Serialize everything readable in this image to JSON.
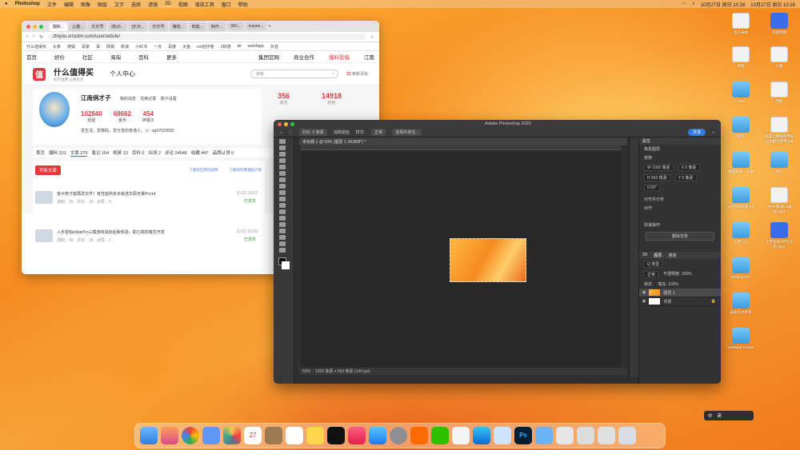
{
  "menubar": {
    "app": "Photoshop",
    "items": [
      "文件",
      "编辑",
      "图像",
      "图层",
      "文字",
      "选择",
      "滤镜",
      "3D",
      "视图",
      "增效工具",
      "窗口",
      "帮助"
    ],
    "datetime1": "10月27日 周日 10:28",
    "datetime2": "10月27日 周日 10:28"
  },
  "browser": {
    "tabs": [
      "翻新...",
      "让模...",
      "乐乐号",
      "[知识...",
      "[乐天...",
      "乐乐号",
      "赚钱...",
      "知能...",
      "制作...",
      "360...",
      "macke..."
    ],
    "url": "zhiyou.smzdm.com/user/article/",
    "bookmarks": [
      "什么值得买",
      "头条",
      "搜狐",
      "百家",
      "毒",
      "网易",
      "新浪",
      "小红书",
      "一点",
      "百度",
      "大鱼",
      "zol创作者",
      "Z财通",
      "kit",
      "web4app",
      "抖音"
    ],
    "nav": [
      "首页",
      "好价",
      "社区",
      "海淘",
      "百科",
      "更多"
    ],
    "nav_right": [
      "集团官网",
      "商业合作",
      "爆料投稿",
      "江南"
    ],
    "brand": "什么值得买",
    "brand_sub": "科学消费 认真生活",
    "center": "个人中心",
    "search_placeholder": "搜索",
    "msg": "72",
    "msg_label": "条新评论",
    "profile": {
      "name": "江南俏才子",
      "links": [
        "我的消息",
        "兑换记录",
        "账户设置"
      ],
      "stats": [
        {
          "v": "102840",
          "l": "经验"
        },
        {
          "v": "68662",
          "l": "金币"
        },
        {
          "v": "454",
          "l": "碎银子"
        }
      ],
      "bio": "爱生活，爱数码，爱分享的普通人。 v：qq67620002",
      "followers": "356",
      "following": "14918",
      "followers_label": "关注",
      "following_label": "粉丝"
    },
    "ptabs": [
      "首页",
      "爆料 201",
      "文章 279",
      "笔记 164",
      "视频 13",
      "百科 0",
      "众测 2",
      "评论 24646",
      "收藏 447",
      "品牌认领 0"
    ],
    "write": "写新文章",
    "link1": "了解社区原创说明",
    "link2": "了解创作者激励计划",
    "articles": [
      {
        "title": "变大修才能再改文件！有性能熟多本就选华硕无畏Pro14",
        "meta": "通知：26 · 评论：14 · 点赞：0",
        "date": "10-23 15:02",
        "status": "已发布"
      },
      {
        "title": "入手雷柏eStarPro三模游戏鼠标后新体验，助力高阶模式开发",
        "meta": "通知：46 · 评论：18 · 点赞：1",
        "date": "10-21 21:09",
        "status": "已发布"
      }
    ]
  },
  "ps": {
    "title": "Adobe Photoshop 2023",
    "doc_tab": "未标题-1 @ 50% (图层 1, RGB/8*) *",
    "options": [
      "羽化: 0 像素",
      "消除锯齿",
      "样式:",
      "正常",
      "选择并遮住..."
    ],
    "share": "共享",
    "status_zoom": "50%",
    "status_size": "1000 像素 x 563 像素 (144 ppi)",
    "props_title": "属性",
    "props_sub": "像素图层",
    "transform": "变换",
    "w": "W 1000 像素",
    "h": "H 563 像素",
    "x": "X 0 像素",
    "y": "Y 0 像素",
    "angle": "0.00°",
    "align": "对齐并分布",
    "align_sub": "对齐:",
    "quick": "快速操作",
    "quick_btn": "删除背景",
    "layer_tabs": [
      "3D",
      "图层",
      "通道"
    ],
    "kind": "Q 类型",
    "blend": "正常",
    "opacity": "不透明度: 100%",
    "lock": "锁定:",
    "fill": "填充: 100%",
    "layers": [
      {
        "name": "图层 1",
        "sel": true
      },
      {
        "name": "背景",
        "sel": false
      }
    ]
  },
  "desktop": [
    {
      "label": "电子表格",
      "k": "doc"
    },
    {
      "label": "高德地图",
      "k": "app"
    },
    {
      "label": "原始",
      "k": "doc"
    },
    {
      "label": "文稿",
      "k": "doc"
    },
    {
      "label": "2020",
      "k": "folder"
    },
    {
      "label": "回收",
      "k": "doc"
    },
    {
      "label": "打印",
      "k": "folder"
    },
    {
      "label": "宽度之路推荐用笔记本配合使用.pdf",
      "k": "doc"
    },
    {
      "label": "微型和阳—本地",
      "k": "folder"
    },
    {
      "label": "照片",
      "k": "folder"
    },
    {
      "label": "10月6日民宿 Eif",
      "k": "folder"
    },
    {
      "label": "WPS 和office录屏.mp4",
      "k": "doc"
    },
    {
      "label": "归档 (1)",
      "k": "folder"
    },
    {
      "label": "大学生周4学习分析.mp4",
      "k": "app"
    },
    {
      "label": "Backup EFI",
      "k": "folder"
    },
    {
      "label": "未命名文件夹",
      "k": "folder"
    },
    {
      "label": "USBMap-master",
      "k": "folder"
    }
  ],
  "ime": [
    "中",
    "英"
  ]
}
